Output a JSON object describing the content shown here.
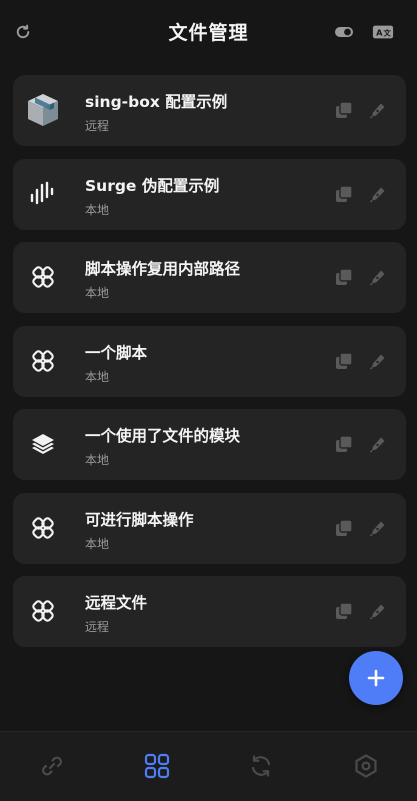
{
  "header": {
    "title": "文件管理",
    "refresh_icon": "refresh-icon",
    "toggle_icon": "toggle-icon",
    "translate_icon": "translate-icon"
  },
  "files": [
    {
      "name": "sing-box 配置示例",
      "type": "远程",
      "icon": "package-box-icon"
    },
    {
      "name": "Surge 伪配置示例",
      "type": "本地",
      "icon": "audio-wave-icon"
    },
    {
      "name": "脚本操作复用内部路径",
      "type": "本地",
      "icon": "script-link-icon"
    },
    {
      "name": "一个脚本",
      "type": "本地",
      "icon": "script-link-icon"
    },
    {
      "name": "一个使用了文件的模块",
      "type": "本地",
      "icon": "layers-icon"
    },
    {
      "name": "可进行脚本操作",
      "type": "本地",
      "icon": "script-link-icon"
    },
    {
      "name": "远程文件",
      "type": "远程",
      "icon": "script-link-icon"
    }
  ],
  "actions": {
    "copy_icon": "copy-icon",
    "edit_icon": "edit-pen-icon"
  },
  "fab": {
    "icon": "plus-icon"
  },
  "bottom_nav": [
    {
      "name": "link-icon",
      "active": false
    },
    {
      "name": "grid-icon",
      "active": true
    },
    {
      "name": "sync-icon",
      "active": false
    },
    {
      "name": "settings-hexagon-icon",
      "active": false
    }
  ],
  "colors": {
    "background": "#161616",
    "card": "#242424",
    "accent": "#4f7cf7",
    "muted_icon": "#5a5a5a",
    "subtitle": "#9a9a9a"
  }
}
